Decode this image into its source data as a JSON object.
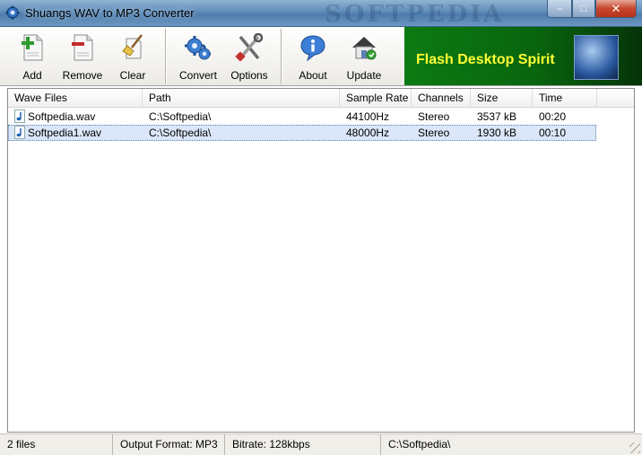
{
  "window": {
    "title": "Shuangs WAV to MP3 Converter",
    "watermark": "SOFTPEDIA",
    "controls": {
      "minimize": "–",
      "maximize": "□",
      "close": "✕"
    }
  },
  "toolbar": {
    "add": "Add",
    "remove": "Remove",
    "clear": "Clear",
    "convert": "Convert",
    "options": "Options",
    "about": "About",
    "update": "Update"
  },
  "banner": {
    "text": "Flash Desktop Spirit"
  },
  "list": {
    "columns": [
      "Wave Files",
      "Path",
      "Sample Rate",
      "Channels",
      "Size",
      "Time"
    ],
    "rows": [
      {
        "file": "Softpedia.wav",
        "path": "C:\\Softpedia\\",
        "rate": "44100Hz",
        "channels": "Stereo",
        "size": "3537 kB",
        "time": "00:20"
      },
      {
        "file": "Softpedia1.wav",
        "path": "C:\\Softpedia\\",
        "rate": "48000Hz",
        "channels": "Stereo",
        "size": "1930 kB",
        "time": "00:10"
      }
    ]
  },
  "status": {
    "count": "2 files",
    "format": "Output Format: MP3",
    "bitrate": "Bitrate: 128kbps",
    "path": "C:\\Softpedia\\"
  },
  "colors": {
    "selection": "#dbe7f8",
    "banner_text": "#ffff33",
    "banner_bg": "#0c7a12"
  },
  "icons": {
    "add": "add-file-icon",
    "remove": "remove-file-icon",
    "clear": "clear-broom-icon",
    "convert": "gears-icon",
    "options": "tools-icon",
    "about": "info-icon",
    "update": "home-icon"
  }
}
